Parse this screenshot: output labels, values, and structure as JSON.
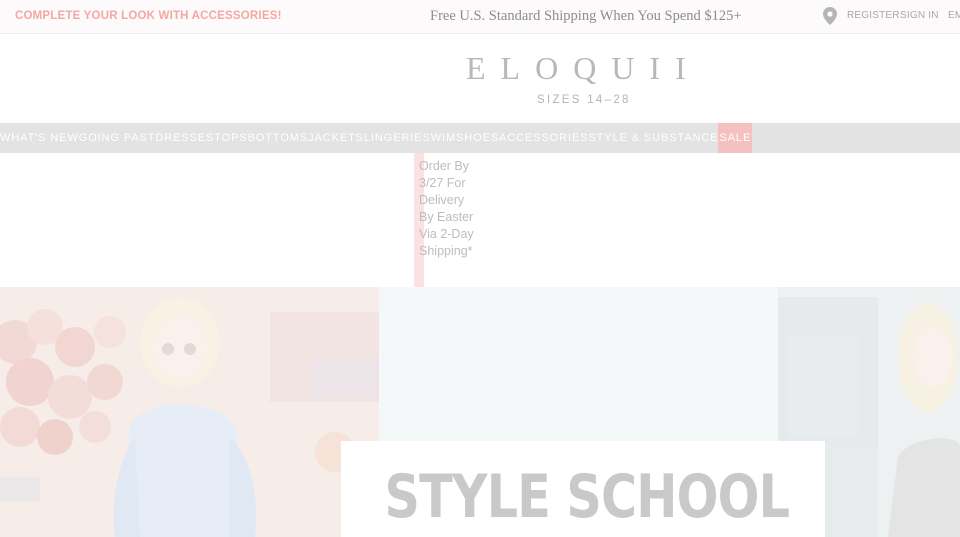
{
  "topbar": {
    "promo_left": "COMPLETE YOUR LOOK WITH ACCESSORIES!",
    "promo_center": "Free U.S. Standard Shipping When You Spend $125+",
    "register": "REGISTER",
    "sign_in": "SIGN IN",
    "em": "EM"
  },
  "brand": {
    "logo": "ELOQUII",
    "tagline": "SIZES 14–28"
  },
  "nav": {
    "items": [
      "WHAT'S NEW",
      "GOING PAST",
      "DRESSES",
      "TOPS",
      "BOTTOMS",
      "JACKETS",
      "LINGERIE",
      "SWIM",
      "SHOES",
      "ACCESSORIES",
      "STYLE & SUBSTANCE",
      "SALE"
    ]
  },
  "order_banner": {
    "text": "Order By 3/27 For Delivery By Easter Via 2-Day Shipping*"
  },
  "hero": {
    "title": "STYLE SCHOOL"
  },
  "colors": {
    "promo_pink": "#f5a7a3",
    "nav_bg": "#e3e3e3",
    "sale_bg": "#f5c1c0"
  }
}
